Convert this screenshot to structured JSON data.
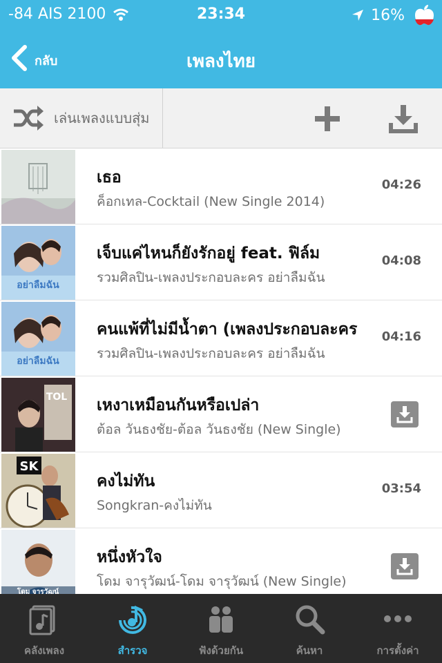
{
  "status": {
    "carrier": "-84 AIS 2100",
    "time": "23:34",
    "battery": "16%"
  },
  "nav": {
    "back_label": "กลับ",
    "title": "เพลงไทย"
  },
  "toolbar": {
    "shuffle_label": "เล่นเพลงแบบสุ่ม"
  },
  "songs": [
    {
      "title": "เธอ",
      "subtitle": "ค็อกเทล-Cocktail (New Single 2014)",
      "duration": "04:26"
    },
    {
      "title": "เจ็บแค่ไหนก็ยังรักอยู่ feat. ฟิล์ม",
      "subtitle": "รวมศิลปิน-เพลงประกอบละคร อย่าลืมฉัน",
      "duration": "04:08"
    },
    {
      "title": "คนแพ้ที่ไม่มีน้ำตา (เพลงประกอบละคร",
      "subtitle": "รวมศิลปิน-เพลงประกอบละคร อย่าลืมฉัน",
      "duration": "04:16"
    },
    {
      "title": "เหงาเหมือนกันหรือเปล่า",
      "subtitle": "ต้อล วันธงชัย-ต้อล วันธงชัย (New Single)",
      "duration": ""
    },
    {
      "title": "คงไม่ทัน",
      "subtitle": "Songkran-คงไม่ทัน",
      "duration": "03:54"
    },
    {
      "title": "หนึ่งหัวใจ",
      "subtitle": "โดม จารุวัฒน์-โดม จารุวัฒน์ (New Single)",
      "duration": ""
    }
  ],
  "album_art_text": {
    "song2": "อย่าลืมฉัน",
    "song3": "อย่าลืมฉัน",
    "song4": "TOL",
    "song5": "SK",
    "song6": "โดม จารุวัฒน์"
  },
  "tabs": [
    {
      "label": "คลังเพลง",
      "icon": "music-library-icon",
      "active": false
    },
    {
      "label": "สำรวจ",
      "icon": "explore-note-icon",
      "active": true
    },
    {
      "label": "ฟังด้วยกัน",
      "icon": "listen-together-icon",
      "active": false
    },
    {
      "label": "ค้นหา",
      "icon": "search-icon",
      "active": false
    },
    {
      "label": "การตั้งค่า",
      "icon": "more-dots-icon",
      "active": false
    }
  ],
  "colors": {
    "accent": "#41b9e3",
    "tabbar": "#2a2a2a",
    "toolbar": "#f1f1f1"
  }
}
